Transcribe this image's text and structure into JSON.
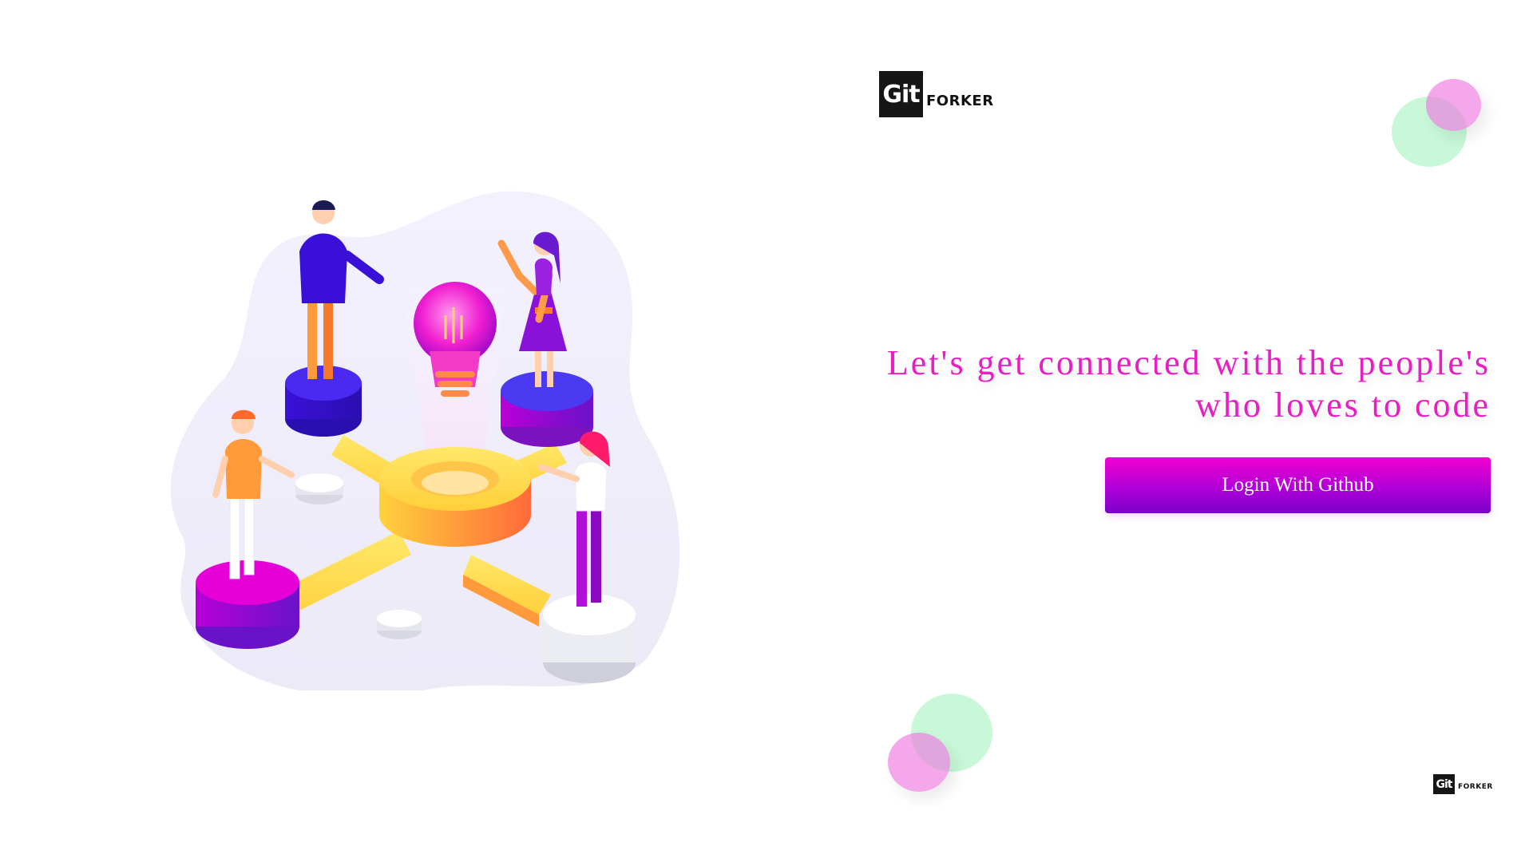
{
  "brand": {
    "logo_mark": "Git",
    "logo_word": "FORKER"
  },
  "hero": {
    "headline_line1": "Let's get connected with the people's",
    "headline_line2": "who loves to code"
  },
  "actions": {
    "login_label": "Login With Github"
  },
  "colors": {
    "accent": "#e81ec4",
    "button_top": "#f200cf",
    "button_bottom": "#7a00c9",
    "circle_green": "#aaf5c3",
    "circle_pink": "#ee78e1"
  },
  "illustration": {
    "icon": "teamwork-lightbulb-illustration"
  }
}
